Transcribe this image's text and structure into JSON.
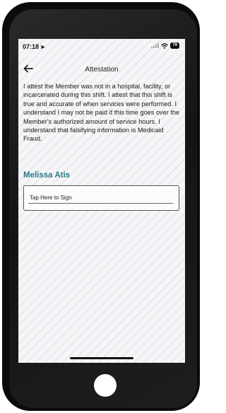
{
  "status_bar": {
    "time": "07:18",
    "location_icon": "location-arrow-icon",
    "wifi_icon": "wifi-icon",
    "battery": "79"
  },
  "header": {
    "title": "Attestation",
    "back_icon": "back-arrow-icon"
  },
  "attestation_text": "I attest the Member was not in a hospital, facility, or incarcerated during this shift. I attest that this shift is true and accurate of when services were performed. I understand I may not be paid if this time goes over the Member's authorized amount of service hours. I understand that falsifying information is Medicaid Fraud.",
  "member_name": "Melissa Atis",
  "signature": {
    "label": "Tap Here to Sign"
  },
  "colors": {
    "accent": "#2a7a86",
    "phone_body": "#0b0b0b"
  }
}
